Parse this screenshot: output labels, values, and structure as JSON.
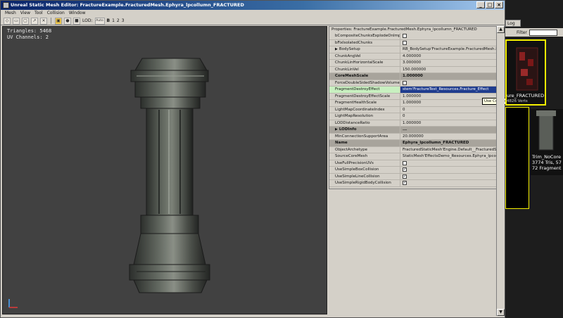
{
  "window": {
    "title": "Unreal Static Mesh Editor: FractureExample.FracturedMesh.Ephyra_lpcollumn_FRACTURED",
    "minimize": "_",
    "maximize": "□",
    "close": "×"
  },
  "menu": [
    "Mesh",
    "View",
    "Tool",
    "Collision",
    "Window"
  ],
  "toolbar": {
    "lod_label": "LOD:",
    "lod_auto": "Auto",
    "lod_base": "B",
    "lod_1": "1",
    "lod_2": "2",
    "lod_3": "3"
  },
  "viewport": {
    "triangles": "Triangles: 5468",
    "uv_channels": "UV Channels: 2"
  },
  "properties": {
    "title": "Properties: FractureExample.FracturedMesh.Ephyra_lpcollumn_FRACTURED",
    "rows": [
      {
        "name": "bCompositeChunksExplodeOnImpact",
        "value": "",
        "checkbox": "unchecked"
      },
      {
        "name": "bFixIsolatedChunks",
        "value": "",
        "checkbox": "unchecked"
      },
      {
        "name": "BodySetup",
        "value": "RB_BodySetup'FractureExample.FracturedMesh.E",
        "expander": "▶"
      },
      {
        "name": "ChunkAngVel",
        "value": "4.000000"
      },
      {
        "name": "ChunkLinHorizontalScale",
        "value": "3.000000"
      },
      {
        "name": "ChunkLinVel",
        "value": "150.000000"
      },
      {
        "name": "CoreMeshScale",
        "value": "1.000000",
        "category": true
      },
      {
        "name": "ForceDoubleSidedShadowVolumes",
        "value": "",
        "checkbox": "unchecked"
      },
      {
        "name": "FragmentDestroyEffect",
        "value": "stem'FractureTest_Resources.Fracture_Effect",
        "highlight": true
      },
      {
        "name": "FragmentDestroyEffectScale",
        "value": "1.000000"
      },
      {
        "name": "FragmentHealthScale",
        "value": "1.000000"
      },
      {
        "name": "LightMapCoordinateIndex",
        "value": "0"
      },
      {
        "name": "LightMapResolution",
        "value": "0"
      },
      {
        "name": "LODDistanceRatio",
        "value": "1.000000"
      },
      {
        "name": "LODInfo",
        "value": "...",
        "expander": "▶",
        "category": true
      },
      {
        "name": "MinConnectionSupportArea",
        "value": "20.000000"
      },
      {
        "name": "Name",
        "value": "Ephyra_lpcollumn_FRACTURED",
        "category": true
      },
      {
        "name": "ObjectArchetype",
        "value": "FracturedStaticMesh'Engine.Default__FracturedStaticMe"
      },
      {
        "name": "SourceCoreMesh",
        "value": "StaticMesh'EffectsDemo_Resources.Ephyra_lpcollumn'"
      },
      {
        "name": "UseFullPrecisionUVs",
        "value": "",
        "checkbox": "unchecked"
      },
      {
        "name": "UseSimpleBoxCollision",
        "value": "",
        "checkbox": "checked"
      },
      {
        "name": "UseSimpleLineCollision",
        "value": "",
        "checkbox": "checked"
      },
      {
        "name": "UseSimpleRigidBodyCollision",
        "value": "",
        "checkbox": "checked"
      }
    ],
    "tooltip": "Use Current Selection In Browser"
  },
  "browser": {
    "tab": "Log",
    "filter_label": "Filter",
    "thumb1_label": "ure_FRACTURED",
    "thumb1_sub": "4826 Verts",
    "thumb3_line1": "Trim_NoCore",
    "thumb3_line2": "3774 Tris, 57",
    "thumb3_line3": "72 Fragment"
  },
  "icons": {
    "app": "mesh-app-icon",
    "expander": "triangle-right-icon",
    "scroll_arrow": "arrow-icon"
  },
  "colors": {
    "title_bar": "#0a246a",
    "selection": "#1f3c8e",
    "highlight_row": "#c8f0c0",
    "thumb_border": "#f5f000",
    "viewport_bg": "#414141"
  }
}
